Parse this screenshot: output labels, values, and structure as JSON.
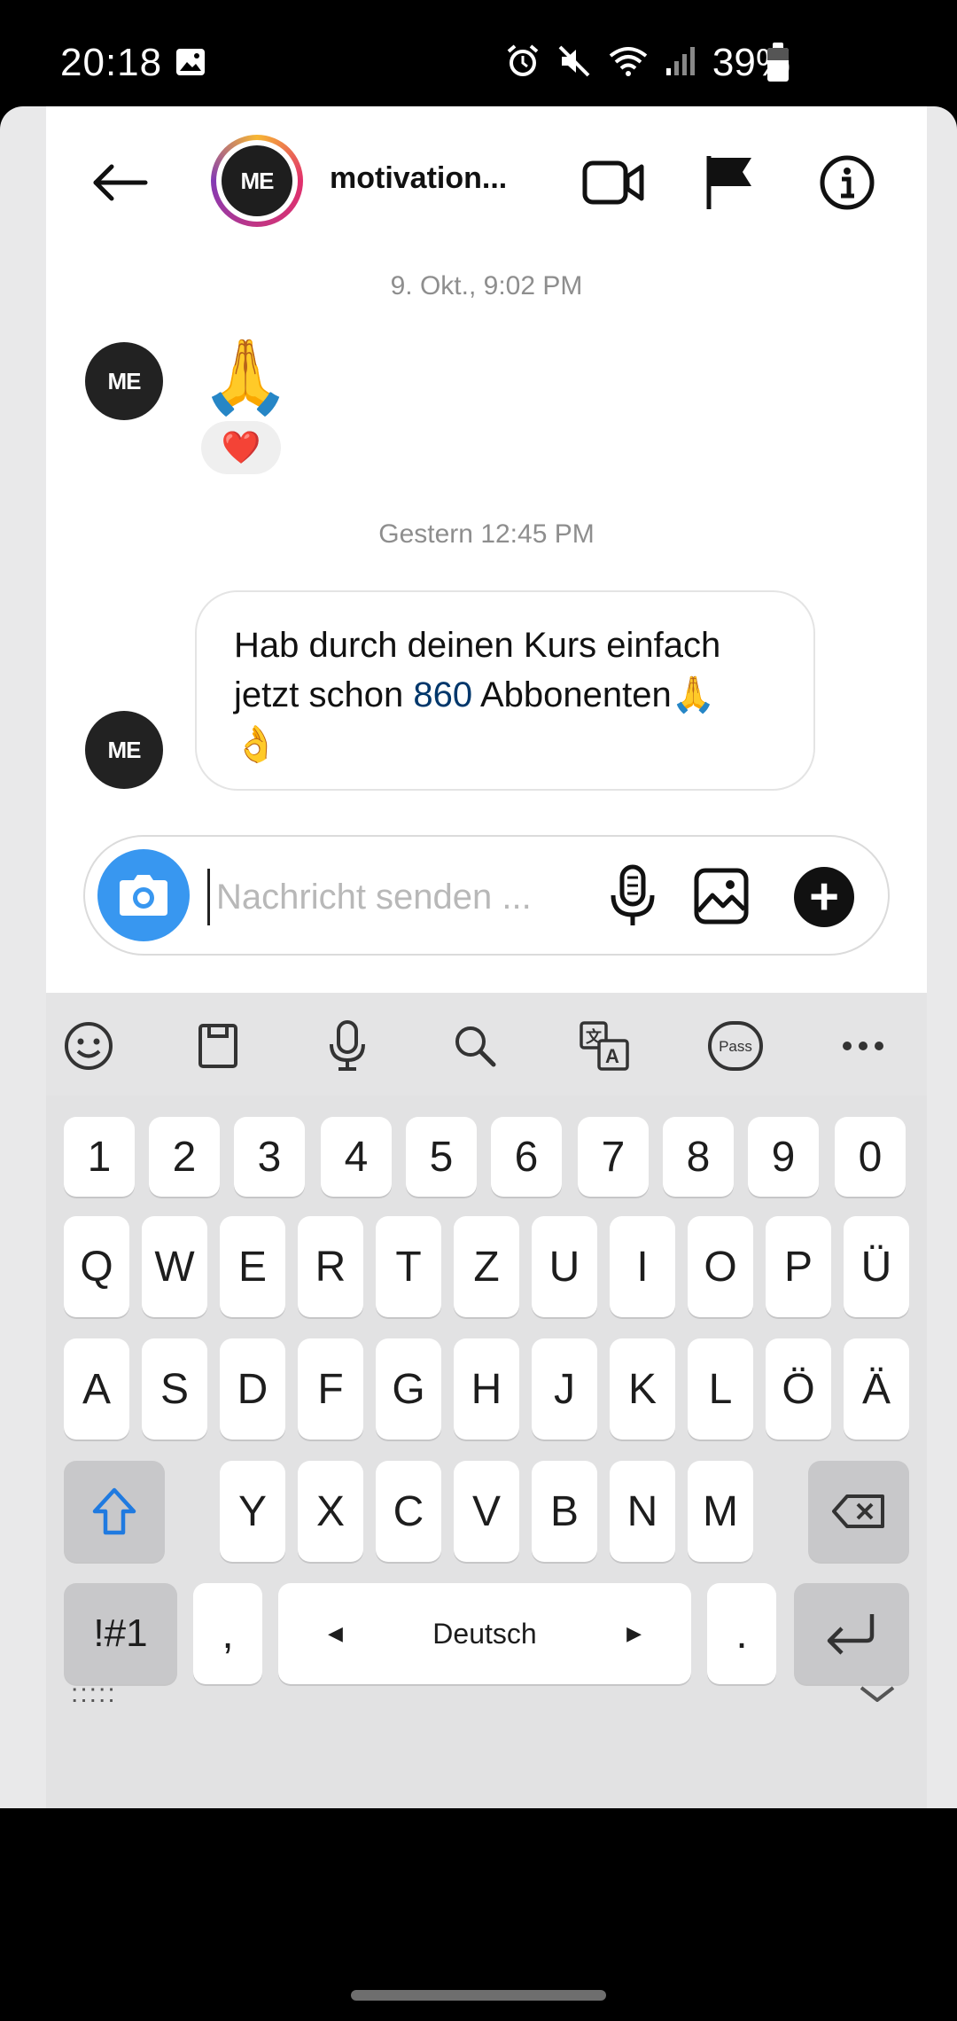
{
  "status_bar": {
    "time": "20:18",
    "battery_percent": "39%",
    "icons": [
      "image-icon",
      "alarm-icon",
      "mute-icon",
      "wifi-icon",
      "signal-icon",
      "battery-icon"
    ]
  },
  "header": {
    "username": "motivation...",
    "avatar_initials": "ME",
    "icons": [
      "back-arrow-icon",
      "video-call-icon",
      "flag-icon",
      "info-icon"
    ]
  },
  "messages": {
    "timestamp_1": "9. Okt., 9:02 PM",
    "msg1_emoji": "🙏",
    "msg1_reaction": "❤️",
    "timestamp_2": "Gestern 12:45 PM",
    "msg2_line1": "Hab durch deinen Kurs einfach",
    "msg2_line2_pre": "jetzt schon ",
    "msg2_number": "860",
    "msg2_line2_post": " Abbonenten🙏",
    "msg2_line3": "👌"
  },
  "composer": {
    "placeholder": "Nachricht senden ...",
    "value": ""
  },
  "keyboard": {
    "toolbar_icons": [
      "emoji-icon",
      "clipboard-icon",
      "mic-icon",
      "search-icon",
      "translate-icon",
      "pass-icon",
      "more-icon"
    ],
    "pass_label": "Pass",
    "row_numbers": [
      "1",
      "2",
      "3",
      "4",
      "5",
      "6",
      "7",
      "8",
      "9",
      "0"
    ],
    "row1": [
      "Q",
      "W",
      "E",
      "R",
      "T",
      "Z",
      "U",
      "I",
      "O",
      "P",
      "Ü"
    ],
    "row2": [
      "A",
      "S",
      "D",
      "F",
      "G",
      "H",
      "J",
      "K",
      "L",
      "Ö",
      "Ä"
    ],
    "row3": [
      "Y",
      "X",
      "C",
      "V",
      "B",
      "N",
      "M"
    ],
    "symbols_label": "!#1",
    "comma": ",",
    "space_label": "Deutsch",
    "period": ".",
    "bottom_dots": ":::::"
  },
  "colors": {
    "accent_blue": "#3897f0",
    "link_number": "#00376b",
    "heart": "#e0245e"
  }
}
